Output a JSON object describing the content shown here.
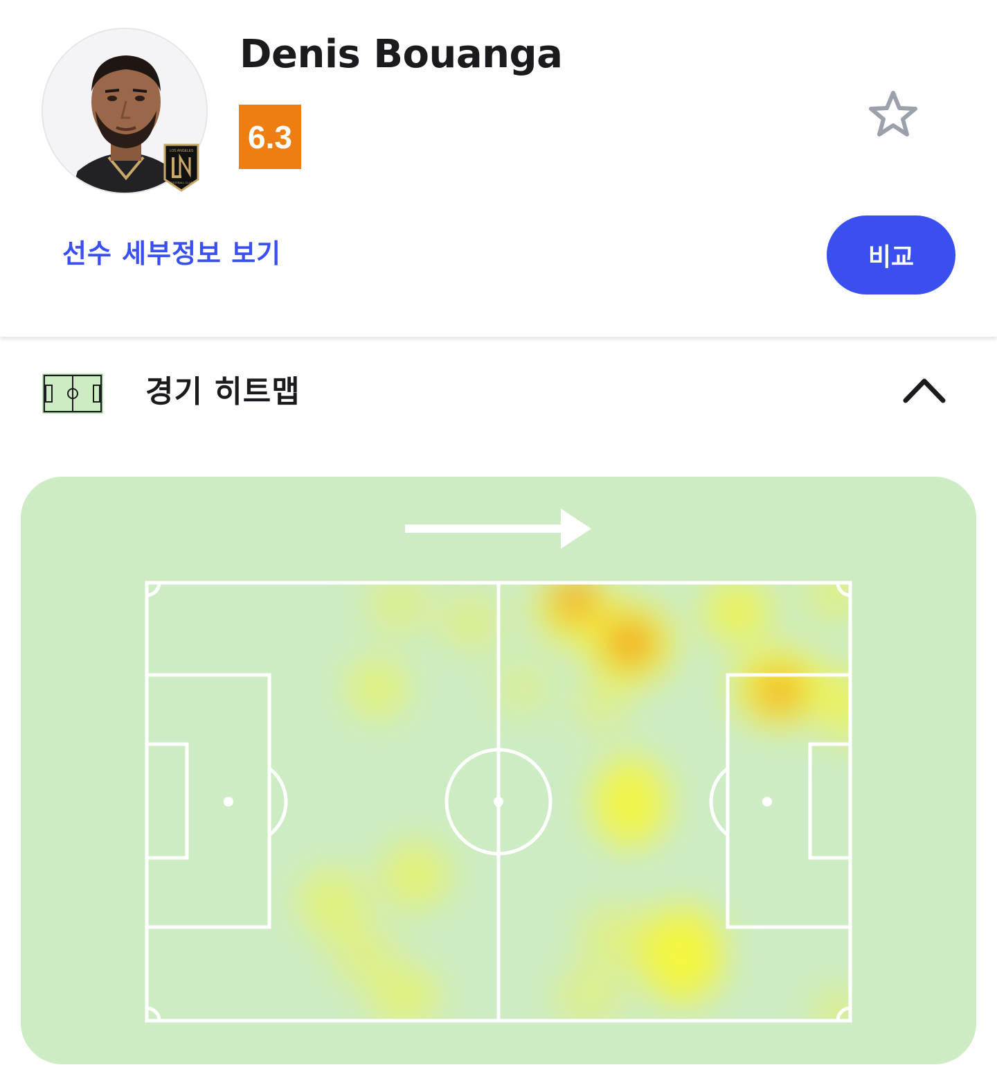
{
  "player": {
    "name": "Denis Bouanga",
    "rating": "6.3",
    "club_badge_text": "LOS ANGELES FOOTBALL CLUB",
    "details_link_label": "선수 세부정보 보기",
    "compare_button_label": "비교"
  },
  "colors": {
    "rating_bg": "#ee7e12",
    "accent_blue": "#3a4ff0",
    "pitch_green": "#cdecc4",
    "heat_yellow": "#f4f53e",
    "heat_orange": "#f08a1a"
  },
  "icons": {
    "favorite": "star-outline-icon",
    "section": "pitch-icon",
    "collapse": "chevron-up-icon",
    "direction": "arrow-right-icon"
  },
  "heatmap_section": {
    "title": "경기 히트맵",
    "expanded": true,
    "attack_direction": "right"
  }
}
